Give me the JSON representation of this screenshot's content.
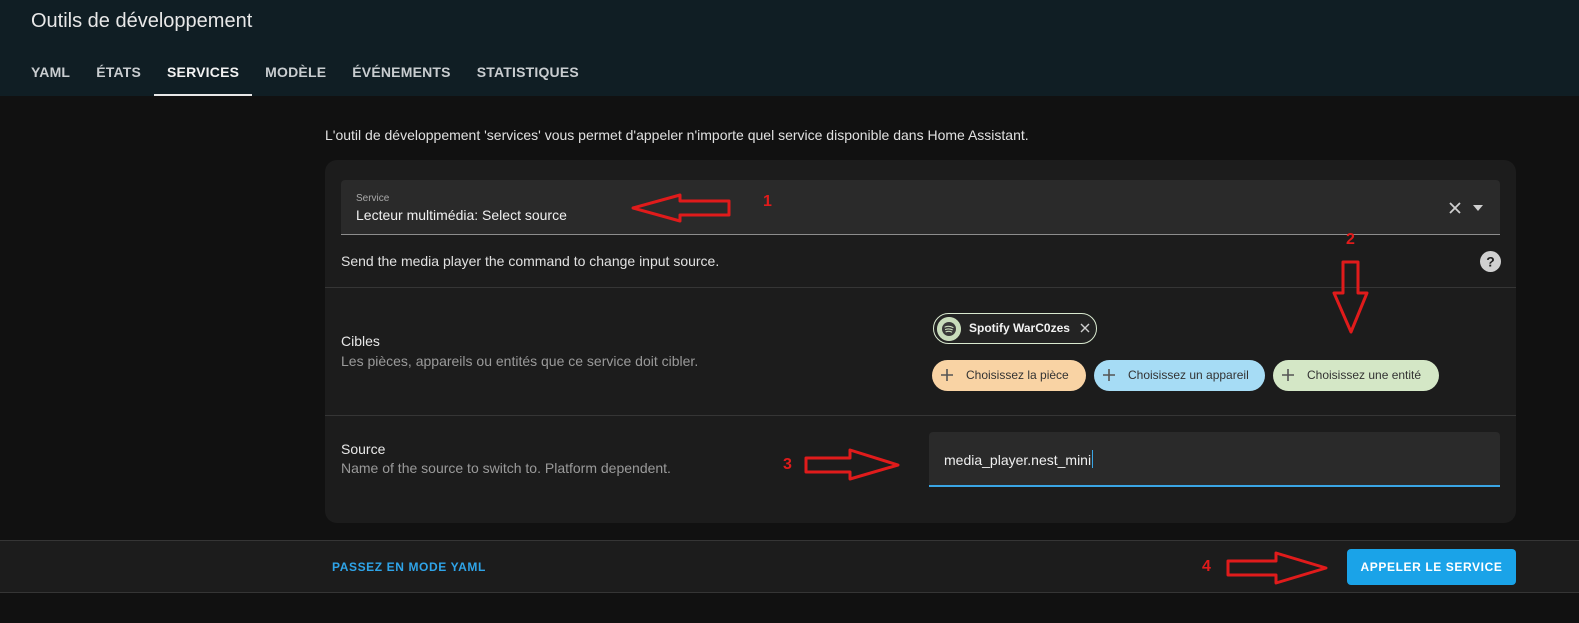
{
  "header": {
    "title": "Outils de développement",
    "tabs": [
      {
        "label": "YAML"
      },
      {
        "label": "ÉTATS"
      },
      {
        "label": "SERVICES"
      },
      {
        "label": "MODÈLE"
      },
      {
        "label": "ÉVÉNEMENTS"
      },
      {
        "label": "STATISTIQUES"
      }
    ],
    "active_tab": "SERVICES"
  },
  "intro_text": "L'outil de développement 'services' vous permet d'appeler n'importe quel service disponible dans Home Assistant.",
  "service_field": {
    "label": "Service",
    "value": "Lecteur multimédia: Select source",
    "clear_icon": "close-icon",
    "dropdown_icon": "chevron-down-icon"
  },
  "service_description": "Send the media player the command to change input source.",
  "targets": {
    "title": "Cibles",
    "description": "Les pièces, appareils ou entités que ce service doit cibler.",
    "selected_chip": {
      "label": "Spotify WarC0zes",
      "icon": "spotify-icon"
    },
    "add_area": "Choisissez la pièce",
    "add_device": "Choisissez un appareil",
    "add_entity": "Choisissez une entité"
  },
  "source": {
    "title": "Source",
    "description": "Name of the source to switch to. Platform dependent.",
    "value": "media_player.nest_mini"
  },
  "footer": {
    "yaml_mode": "PASSEZ EN MODE YAML",
    "call_service": "APPELER LE SERVICE"
  },
  "annotations": {
    "n1": "1",
    "n2": "2",
    "n3": "3",
    "n4": "4",
    "color": "#e01b1b"
  },
  "colors": {
    "accent": "#1aa3e8",
    "header_bg": "#101e24",
    "chip_area": "#f9d3a4",
    "chip_device": "#a6dcf5",
    "chip_entity": "#d4e7c6"
  }
}
